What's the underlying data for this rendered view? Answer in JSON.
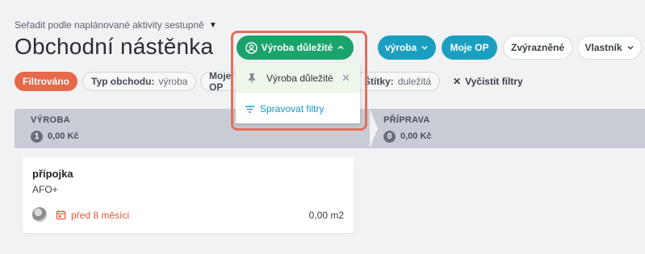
{
  "header": {
    "sort_label": "Seřadit podle naplánované aktivity sestupně",
    "title": "Obchodní nástěnka"
  },
  "toolbar": {
    "active_filter": "Výroba důležité",
    "vyroba": "výroba",
    "moje_op": "Moje OP",
    "zvyraznene": "Zvýrazněné",
    "vlastnik": "Vlastník"
  },
  "filters": {
    "status": "Filtrováno",
    "chips": [
      {
        "key": "Typ obchodu:",
        "value": "výroba"
      },
      {
        "key": "Moje OP",
        "value": ""
      },
      {
        "key": "Štítky:",
        "value": "duležitá"
      }
    ],
    "clear_label": "Vyčistit filtry"
  },
  "dropdown": {
    "item_label": "Výroba důležité",
    "manage_label": "Spravovat filtry"
  },
  "pipeline": {
    "stages": [
      {
        "name": "VÝROBA",
        "count": "1",
        "amount": "0,00 Kč"
      },
      {
        "name": "PŘÍPRAVA",
        "count": "0",
        "amount": "0,00 Kč"
      }
    ]
  },
  "card": {
    "title": "přípojka",
    "subtitle": "AFO+",
    "due": "před 8 měsíci",
    "amount": "0,00 m2"
  },
  "colors": {
    "accent_teal": "#1a9fc1",
    "accent_green": "#1aa36a",
    "accent_orange": "#e5694a",
    "due_red": "#e2583d"
  }
}
